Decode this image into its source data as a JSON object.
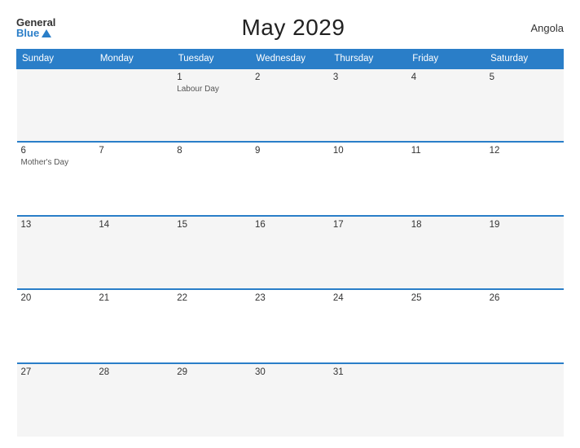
{
  "logo": {
    "general": "General",
    "blue": "Blue"
  },
  "title": "May 2029",
  "country": "Angola",
  "weekdays": [
    "Sunday",
    "Monday",
    "Tuesday",
    "Wednesday",
    "Thursday",
    "Friday",
    "Saturday"
  ],
  "weeks": [
    [
      {
        "num": "",
        "holiday": ""
      },
      {
        "num": "",
        "holiday": ""
      },
      {
        "num": "1",
        "holiday": "Labour Day"
      },
      {
        "num": "2",
        "holiday": ""
      },
      {
        "num": "3",
        "holiday": ""
      },
      {
        "num": "4",
        "holiday": ""
      },
      {
        "num": "5",
        "holiday": ""
      }
    ],
    [
      {
        "num": "6",
        "holiday": "Mother's Day"
      },
      {
        "num": "7",
        "holiday": ""
      },
      {
        "num": "8",
        "holiday": ""
      },
      {
        "num": "9",
        "holiday": ""
      },
      {
        "num": "10",
        "holiday": ""
      },
      {
        "num": "11",
        "holiday": ""
      },
      {
        "num": "12",
        "holiday": ""
      }
    ],
    [
      {
        "num": "13",
        "holiday": ""
      },
      {
        "num": "14",
        "holiday": ""
      },
      {
        "num": "15",
        "holiday": ""
      },
      {
        "num": "16",
        "holiday": ""
      },
      {
        "num": "17",
        "holiday": ""
      },
      {
        "num": "18",
        "holiday": ""
      },
      {
        "num": "19",
        "holiday": ""
      }
    ],
    [
      {
        "num": "20",
        "holiday": ""
      },
      {
        "num": "21",
        "holiday": ""
      },
      {
        "num": "22",
        "holiday": ""
      },
      {
        "num": "23",
        "holiday": ""
      },
      {
        "num": "24",
        "holiday": ""
      },
      {
        "num": "25",
        "holiday": ""
      },
      {
        "num": "26",
        "holiday": ""
      }
    ],
    [
      {
        "num": "27",
        "holiday": ""
      },
      {
        "num": "28",
        "holiday": ""
      },
      {
        "num": "29",
        "holiday": ""
      },
      {
        "num": "30",
        "holiday": ""
      },
      {
        "num": "31",
        "holiday": ""
      },
      {
        "num": "",
        "holiday": ""
      },
      {
        "num": "",
        "holiday": ""
      }
    ]
  ]
}
